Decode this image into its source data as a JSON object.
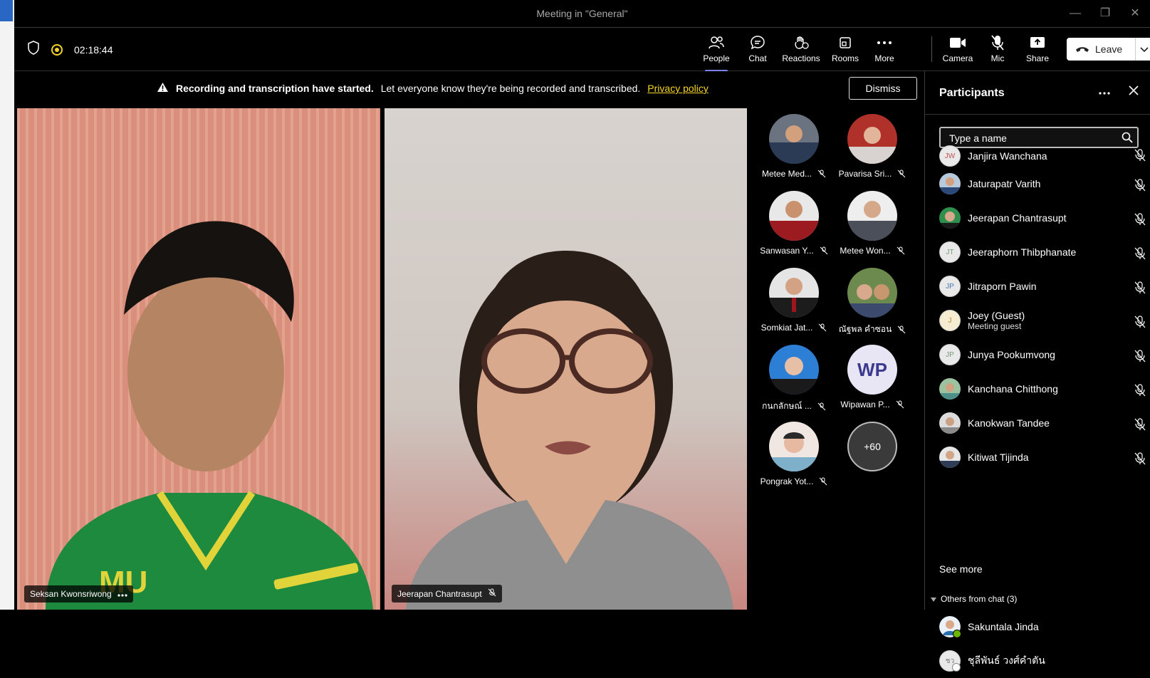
{
  "window": {
    "title": "Meeting in \"General\""
  },
  "toolbar": {
    "timer": "02:18:44",
    "people": "People",
    "chat": "Chat",
    "reactions": "Reactions",
    "rooms": "Rooms",
    "more": "More",
    "camera": "Camera",
    "mic": "Mic",
    "share": "Share",
    "leave": "Leave"
  },
  "banner": {
    "bold": "Recording and transcription have started.",
    "text": "Let everyone know they're being recorded and transcribed.",
    "link": "Privacy policy",
    "dismiss": "Dismiss"
  },
  "videos": [
    {
      "name": "Seksan Kwonsriwong"
    },
    {
      "name": "Jeerapan Chantrasupt"
    }
  ],
  "gallery": [
    {
      "name": "Metee Med..."
    },
    {
      "name": "Pavarisa Sri..."
    },
    {
      "name": "Sanwasan Y..."
    },
    {
      "name": "Metee Won..."
    },
    {
      "name": "Somkiat Jat..."
    },
    {
      "name": "ณัฐพล คำซอน"
    },
    {
      "name": "กนกลักษณ์ ..."
    },
    {
      "name": "Wipawan P...",
      "initials": "WP"
    },
    {
      "name": "Pongrak Yot..."
    },
    {
      "more": "+60"
    }
  ],
  "panel": {
    "title": "Participants",
    "search_placeholder": "Type a name",
    "participants": [
      {
        "name": "Janjira Wanchana",
        "initials": "JW"
      },
      {
        "name": "Jaturapatr Varith"
      },
      {
        "name": "Jeerapan Chantrasupt"
      },
      {
        "name": "Jeeraphorn Thibphanate",
        "initials": "JT"
      },
      {
        "name": "Jitraporn Pawin",
        "initials": "JP"
      },
      {
        "name": "Joey (Guest)",
        "sub": "Meeting guest",
        "initials": "J"
      },
      {
        "name": "Junya Pookumvong",
        "initials": "JP"
      },
      {
        "name": "Kanchana Chitthong"
      },
      {
        "name": "Kanokwan Tandee"
      },
      {
        "name": "Kitiwat Tijinda"
      }
    ],
    "see_more": "See more",
    "others_label": "Others from chat (3)",
    "chat_people": [
      {
        "name": "Sakuntala Jinda"
      },
      {
        "name": "ชุลีพันธ์ วงศ์คำตัน",
        "initials": "ชว"
      }
    ]
  },
  "colors": {
    "accent": "#7b83eb",
    "recording": "#f5d523",
    "link": "#f5d523"
  }
}
